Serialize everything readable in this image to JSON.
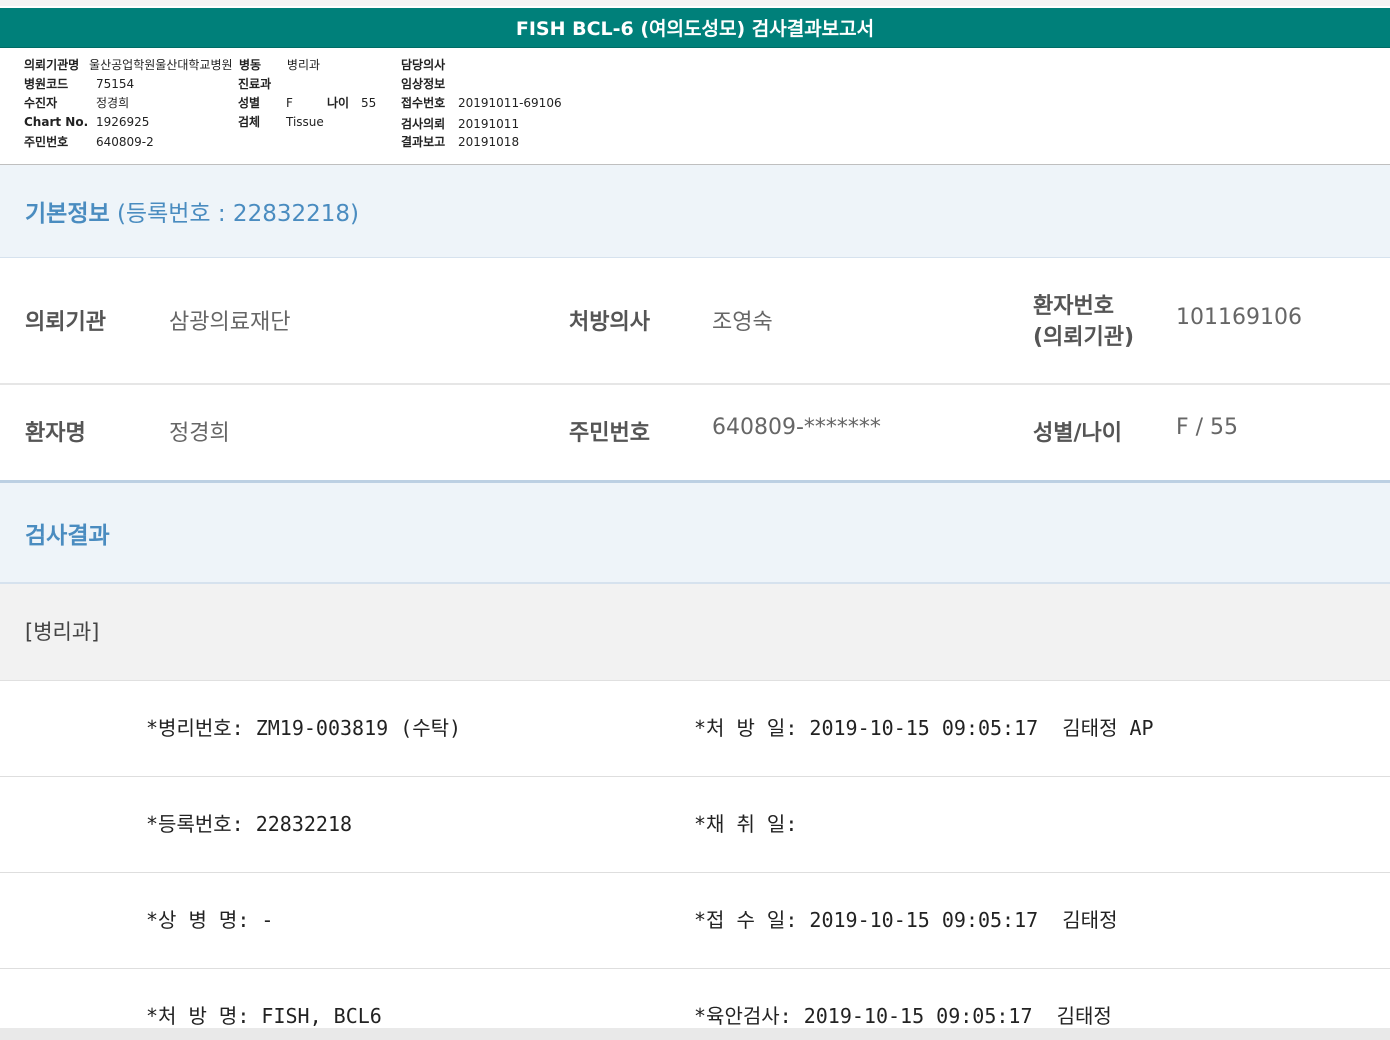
{
  "title": "FISH BCL-6 (여의도성모) 검사결과보고서",
  "header": {
    "requesting_institution": {
      "label": "의뢰기관명",
      "value": "울산공업학원울산대학교병원"
    },
    "ward": {
      "label": "병동",
      "value": "병리과"
    },
    "attending_doctor": {
      "label": "담당의사",
      "value": ""
    },
    "hospital_code": {
      "label": "병원코드",
      "value": "75154"
    },
    "department": {
      "label": "진료과",
      "value": ""
    },
    "clinical_info": {
      "label": "임상정보",
      "value": ""
    },
    "recipient": {
      "label": "수진자",
      "value": "정경희"
    },
    "sex": {
      "label": "성별",
      "value": "F"
    },
    "age": {
      "label": "나이",
      "value": "55"
    },
    "accession_no": {
      "label": "접수번호",
      "value": "20191011-69106"
    },
    "chart_no": {
      "label": "Chart No.",
      "value": "1926925"
    },
    "specimen": {
      "label": "검체",
      "value": "Tissue"
    },
    "test_request": {
      "label": "검사의뢰",
      "value": "20191011"
    },
    "resident_no": {
      "label": "주민번호",
      "value": "640809-2"
    },
    "result_report": {
      "label": "결과보고",
      "value": "20191018"
    }
  },
  "basic_info": {
    "heading": "기본정보",
    "reg_label": "(등록번호 : 22832218)",
    "institution_label": "의뢰기관",
    "institution_value": "삼광의료재단",
    "doctor_label": "처방의사",
    "doctor_value": "조영숙",
    "patient_no_label_1": "환자번호",
    "patient_no_label_2": "(의뢰기관)",
    "patient_no_value": "101169106",
    "name_label": "환자명",
    "name_value": "정경희",
    "rrn_label": "주민번호",
    "rrn_value": "640809-*******",
    "sexage_label": "성별/나이",
    "sexage_value": "F / 55"
  },
  "results": {
    "heading": "검사결과",
    "department": "[병리과]",
    "rows": [
      {
        "left": "*병리번호: ZM19-003819 (수탁)",
        "right": "*처 방 일: 2019-10-15 09:05:17  김태정 AP"
      },
      {
        "left": "*등록번호: 22832218",
        "right": "*채 취 일:"
      },
      {
        "left": "*상 병 명: -",
        "right": "*접 수 일: 2019-10-15 09:05:17  김태정"
      },
      {
        "left": "*처 방 명: FISH, BCL6",
        "right": "*육안검사: 2019-10-15 09:05:17  김태정"
      }
    ]
  }
}
